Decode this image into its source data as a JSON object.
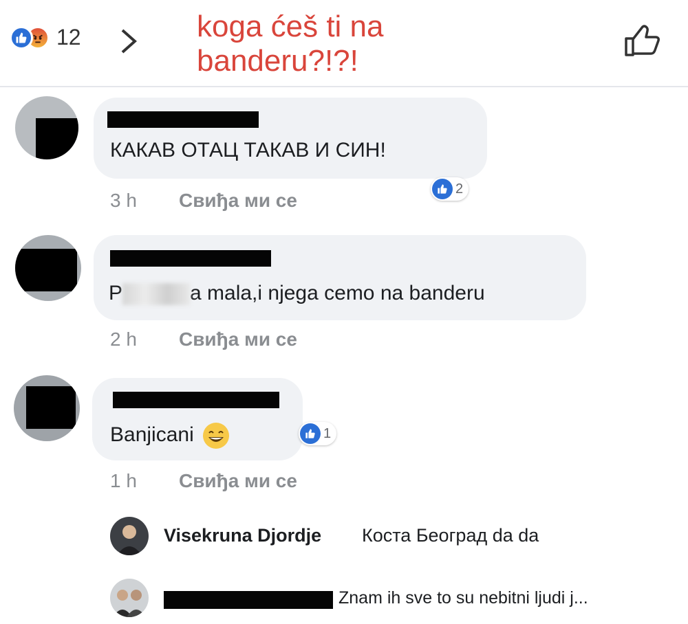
{
  "header": {
    "reaction_count": "12",
    "overlay_text": "koga ćeš ti na banderu?!?!"
  },
  "comments": [
    {
      "text": "КАКАВ ОТАЦ ТАКАВ И СИН!",
      "time": "3 h",
      "like_label": "Свиђа ми се",
      "like_count": "2"
    },
    {
      "text_prefix": "P",
      "text_suffix": "a mala,i njega cemo na banderu",
      "time": "2 h",
      "like_label": "Свиђа ми се"
    },
    {
      "text": "Banjicani",
      "time": "1 h",
      "like_label": "Свиђа ми се",
      "like_count": "1"
    }
  ],
  "replies": [
    {
      "name": "Visekruna Djordje",
      "text": "Коста Београд da da"
    },
    {
      "text": "Znam ih sve to su nebitni ljudi j..."
    }
  ],
  "colors": {
    "accent_blue": "#2b6fd6",
    "overlay_red": "#d9453b",
    "bubble_bg": "#f0f2f5"
  }
}
